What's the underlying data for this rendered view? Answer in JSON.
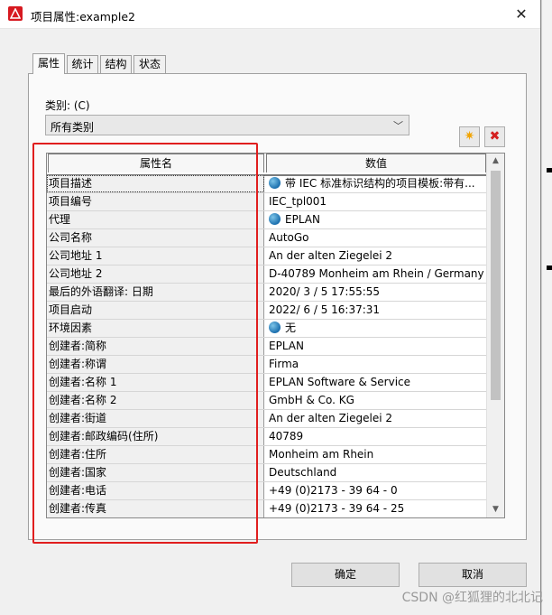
{
  "window": {
    "title": "项目属性:example2",
    "close_glyph": "✕"
  },
  "tabs": [
    {
      "label": "属性",
      "active": true
    },
    {
      "label": "统计",
      "active": false
    },
    {
      "label": "结构",
      "active": false
    },
    {
      "label": "状态",
      "active": false
    }
  ],
  "category": {
    "label": "类别: (C)",
    "value": "所有类别",
    "chevron": "﹀"
  },
  "toolbar": {
    "new_glyph": "✷",
    "delete_glyph": "✖"
  },
  "grid": {
    "columns": [
      "属性名",
      "数值"
    ],
    "rows": [
      {
        "name": "项目描述",
        "value": "带 IEC 标准标识结构的项目模板:带有...",
        "icon": "globe-icon",
        "selected": true
      },
      {
        "name": "项目编号",
        "value": "IEC_tpl001",
        "icon": ""
      },
      {
        "name": "代理",
        "value": "EPLAN",
        "icon": "globe-icon"
      },
      {
        "name": "公司名称",
        "value": "AutoGo",
        "icon": ""
      },
      {
        "name": "公司地址 1",
        "value": "An der alten Ziegelei 2",
        "icon": ""
      },
      {
        "name": "公司地址 2",
        "value": "D-40789 Monheim am Rhein / Germany",
        "icon": ""
      },
      {
        "name": "最后的外语翻译: 日期",
        "value": "2020/ 3 / 5  17:55:55",
        "icon": ""
      },
      {
        "name": "项目启动",
        "value": "2022/ 6 / 5  16:37:31",
        "icon": ""
      },
      {
        "name": "环境因素",
        "value": "无",
        "icon": "globe-icon"
      },
      {
        "name": "创建者:简称",
        "value": "EPLAN",
        "icon": ""
      },
      {
        "name": "创建者:称谓",
        "value": "Firma",
        "icon": ""
      },
      {
        "name": "创建者:名称 1",
        "value": "EPLAN Software & Service",
        "icon": ""
      },
      {
        "name": "创建者:名称 2",
        "value": "GmbH & Co. KG",
        "icon": ""
      },
      {
        "name": "创建者:街道",
        "value": "An der alten Ziegelei 2",
        "icon": ""
      },
      {
        "name": "创建者:邮政编码(住所)",
        "value": "40789",
        "icon": ""
      },
      {
        "name": "创建者:住所",
        "value": "Monheim am Rhein",
        "icon": ""
      },
      {
        "name": "创建者:国家",
        "value": "Deutschland",
        "icon": ""
      },
      {
        "name": "创建者:电话",
        "value": "+49 (0)2173 - 39 64 - 0",
        "icon": ""
      },
      {
        "name": "创建者:传真",
        "value": "+49 (0)2173 - 39 64 - 25",
        "icon": ""
      }
    ],
    "scroll_up": "▲",
    "scroll_down": "▼"
  },
  "buttons": {
    "ok": "确定",
    "cancel": "取消"
  },
  "watermark": "CSDN @红狐狸的北北记",
  "colors": {
    "highlight": "#e01e1e",
    "brand": "#d71920"
  }
}
